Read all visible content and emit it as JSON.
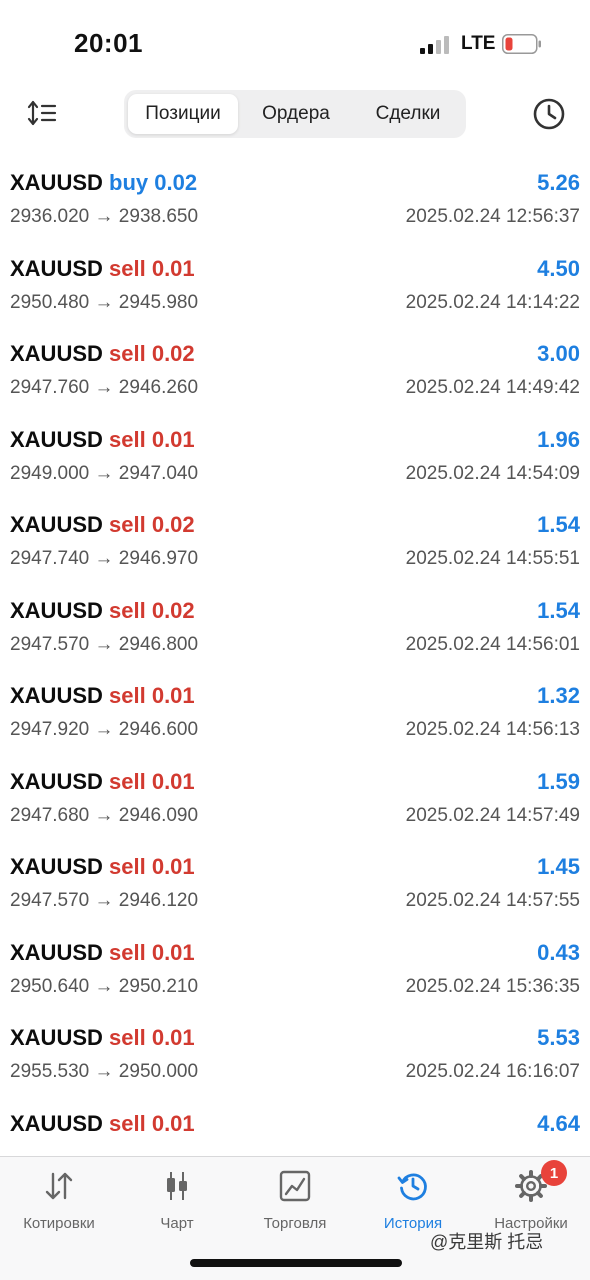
{
  "status": {
    "time": "20:01",
    "network": "LTE",
    "battery_color": "#e8433b"
  },
  "toolbar": {
    "sort_icon": "sort-icon",
    "history_icon": "clock-icon",
    "segments": [
      "Позиции",
      "Ордера",
      "Сделки"
    ],
    "active_segment": "Позиции"
  },
  "colors": {
    "accent": "#1e7fe0",
    "buy": "#1e7fe0",
    "sell": "#d23a30"
  },
  "deals": [
    {
      "symbol": "XAUUSD",
      "side": "buy 0.02",
      "type": "buy",
      "profit": "5.26",
      "prices": "2936.020 → 2938.650",
      "time": "2025.02.24 12:56:37"
    },
    {
      "symbol": "XAUUSD",
      "side": "sell 0.01",
      "type": "sell",
      "profit": "4.50",
      "prices": "2950.480 → 2945.980",
      "time": "2025.02.24 14:14:22"
    },
    {
      "symbol": "XAUUSD",
      "side": "sell 0.02",
      "type": "sell",
      "profit": "3.00",
      "prices": "2947.760 → 2946.260",
      "time": "2025.02.24 14:49:42"
    },
    {
      "symbol": "XAUUSD",
      "side": "sell 0.01",
      "type": "sell",
      "profit": "1.96",
      "prices": "2949.000 → 2947.040",
      "time": "2025.02.24 14:54:09"
    },
    {
      "symbol": "XAUUSD",
      "side": "sell 0.02",
      "type": "sell",
      "profit": "1.54",
      "prices": "2947.740 → 2946.970",
      "time": "2025.02.24 14:55:51"
    },
    {
      "symbol": "XAUUSD",
      "side": "sell 0.02",
      "type": "sell",
      "profit": "1.54",
      "prices": "2947.570 → 2946.800",
      "time": "2025.02.24 14:56:01"
    },
    {
      "symbol": "XAUUSD",
      "side": "sell 0.01",
      "type": "sell",
      "profit": "1.32",
      "prices": "2947.920 → 2946.600",
      "time": "2025.02.24 14:56:13"
    },
    {
      "symbol": "XAUUSD",
      "side": "sell 0.01",
      "type": "sell",
      "profit": "1.59",
      "prices": "2947.680 → 2946.090",
      "time": "2025.02.24 14:57:49"
    },
    {
      "symbol": "XAUUSD",
      "side": "sell 0.01",
      "type": "sell",
      "profit": "1.45",
      "prices": "2947.570 → 2946.120",
      "time": "2025.02.24 14:57:55"
    },
    {
      "symbol": "XAUUSD",
      "side": "sell 0.01",
      "type": "sell",
      "profit": "0.43",
      "prices": "2950.640 → 2950.210",
      "time": "2025.02.24 15:36:35"
    },
    {
      "symbol": "XAUUSD",
      "side": "sell 0.01",
      "type": "sell",
      "profit": "5.53",
      "prices": "2955.530 → 2950.000",
      "time": "2025.02.24 16:16:07"
    },
    {
      "symbol": "XAUUSD",
      "side": "sell 0.01",
      "type": "sell",
      "profit": "4.64",
      "prices": "",
      "time": ""
    }
  ],
  "tabbar": {
    "tabs": [
      {
        "label": "Котировки",
        "icon": "quotes-icon"
      },
      {
        "label": "Чарт",
        "icon": "candles-icon"
      },
      {
        "label": "Торговля",
        "icon": "trade-chart-icon"
      },
      {
        "label": "История",
        "icon": "history-icon"
      },
      {
        "label": "Настройки",
        "icon": "gear-icon"
      }
    ],
    "active_tab": "История",
    "settings_badge": "1"
  },
  "watermark": "@克里斯 托忌"
}
